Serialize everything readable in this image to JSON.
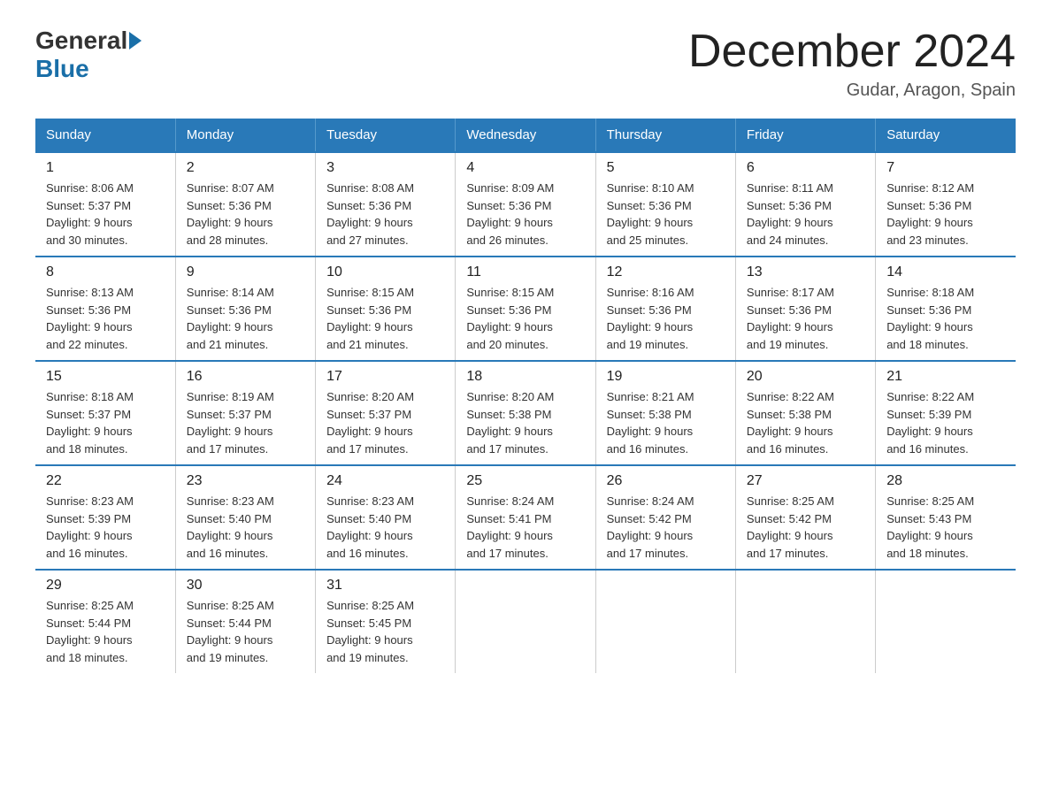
{
  "logo": {
    "text_general": "General",
    "text_blue": "Blue"
  },
  "title": "December 2024",
  "subtitle": "Gudar, Aragon, Spain",
  "days_of_week": [
    "Sunday",
    "Monday",
    "Tuesday",
    "Wednesday",
    "Thursday",
    "Friday",
    "Saturday"
  ],
  "weeks": [
    [
      {
        "num": "1",
        "sunrise": "8:06 AM",
        "sunset": "5:37 PM",
        "daylight": "9 hours and 30 minutes."
      },
      {
        "num": "2",
        "sunrise": "8:07 AM",
        "sunset": "5:36 PM",
        "daylight": "9 hours and 28 minutes."
      },
      {
        "num": "3",
        "sunrise": "8:08 AM",
        "sunset": "5:36 PM",
        "daylight": "9 hours and 27 minutes."
      },
      {
        "num": "4",
        "sunrise": "8:09 AM",
        "sunset": "5:36 PM",
        "daylight": "9 hours and 26 minutes."
      },
      {
        "num": "5",
        "sunrise": "8:10 AM",
        "sunset": "5:36 PM",
        "daylight": "9 hours and 25 minutes."
      },
      {
        "num": "6",
        "sunrise": "8:11 AM",
        "sunset": "5:36 PM",
        "daylight": "9 hours and 24 minutes."
      },
      {
        "num": "7",
        "sunrise": "8:12 AM",
        "sunset": "5:36 PM",
        "daylight": "9 hours and 23 minutes."
      }
    ],
    [
      {
        "num": "8",
        "sunrise": "8:13 AM",
        "sunset": "5:36 PM",
        "daylight": "9 hours and 22 minutes."
      },
      {
        "num": "9",
        "sunrise": "8:14 AM",
        "sunset": "5:36 PM",
        "daylight": "9 hours and 21 minutes."
      },
      {
        "num": "10",
        "sunrise": "8:15 AM",
        "sunset": "5:36 PM",
        "daylight": "9 hours and 21 minutes."
      },
      {
        "num": "11",
        "sunrise": "8:15 AM",
        "sunset": "5:36 PM",
        "daylight": "9 hours and 20 minutes."
      },
      {
        "num": "12",
        "sunrise": "8:16 AM",
        "sunset": "5:36 PM",
        "daylight": "9 hours and 19 minutes."
      },
      {
        "num": "13",
        "sunrise": "8:17 AM",
        "sunset": "5:36 PM",
        "daylight": "9 hours and 19 minutes."
      },
      {
        "num": "14",
        "sunrise": "8:18 AM",
        "sunset": "5:36 PM",
        "daylight": "9 hours and 18 minutes."
      }
    ],
    [
      {
        "num": "15",
        "sunrise": "8:18 AM",
        "sunset": "5:37 PM",
        "daylight": "9 hours and 18 minutes."
      },
      {
        "num": "16",
        "sunrise": "8:19 AM",
        "sunset": "5:37 PM",
        "daylight": "9 hours and 17 minutes."
      },
      {
        "num": "17",
        "sunrise": "8:20 AM",
        "sunset": "5:37 PM",
        "daylight": "9 hours and 17 minutes."
      },
      {
        "num": "18",
        "sunrise": "8:20 AM",
        "sunset": "5:38 PM",
        "daylight": "9 hours and 17 minutes."
      },
      {
        "num": "19",
        "sunrise": "8:21 AM",
        "sunset": "5:38 PM",
        "daylight": "9 hours and 16 minutes."
      },
      {
        "num": "20",
        "sunrise": "8:22 AM",
        "sunset": "5:38 PM",
        "daylight": "9 hours and 16 minutes."
      },
      {
        "num": "21",
        "sunrise": "8:22 AM",
        "sunset": "5:39 PM",
        "daylight": "9 hours and 16 minutes."
      }
    ],
    [
      {
        "num": "22",
        "sunrise": "8:23 AM",
        "sunset": "5:39 PM",
        "daylight": "9 hours and 16 minutes."
      },
      {
        "num": "23",
        "sunrise": "8:23 AM",
        "sunset": "5:40 PM",
        "daylight": "9 hours and 16 minutes."
      },
      {
        "num": "24",
        "sunrise": "8:23 AM",
        "sunset": "5:40 PM",
        "daylight": "9 hours and 16 minutes."
      },
      {
        "num": "25",
        "sunrise": "8:24 AM",
        "sunset": "5:41 PM",
        "daylight": "9 hours and 17 minutes."
      },
      {
        "num": "26",
        "sunrise": "8:24 AM",
        "sunset": "5:42 PM",
        "daylight": "9 hours and 17 minutes."
      },
      {
        "num": "27",
        "sunrise": "8:25 AM",
        "sunset": "5:42 PM",
        "daylight": "9 hours and 17 minutes."
      },
      {
        "num": "28",
        "sunrise": "8:25 AM",
        "sunset": "5:43 PM",
        "daylight": "9 hours and 18 minutes."
      }
    ],
    [
      {
        "num": "29",
        "sunrise": "8:25 AM",
        "sunset": "5:44 PM",
        "daylight": "9 hours and 18 minutes."
      },
      {
        "num": "30",
        "sunrise": "8:25 AM",
        "sunset": "5:44 PM",
        "daylight": "9 hours and 19 minutes."
      },
      {
        "num": "31",
        "sunrise": "8:25 AM",
        "sunset": "5:45 PM",
        "daylight": "9 hours and 19 minutes."
      },
      null,
      null,
      null,
      null
    ]
  ],
  "labels": {
    "sunrise": "Sunrise:",
    "sunset": "Sunset:",
    "daylight": "Daylight:"
  }
}
